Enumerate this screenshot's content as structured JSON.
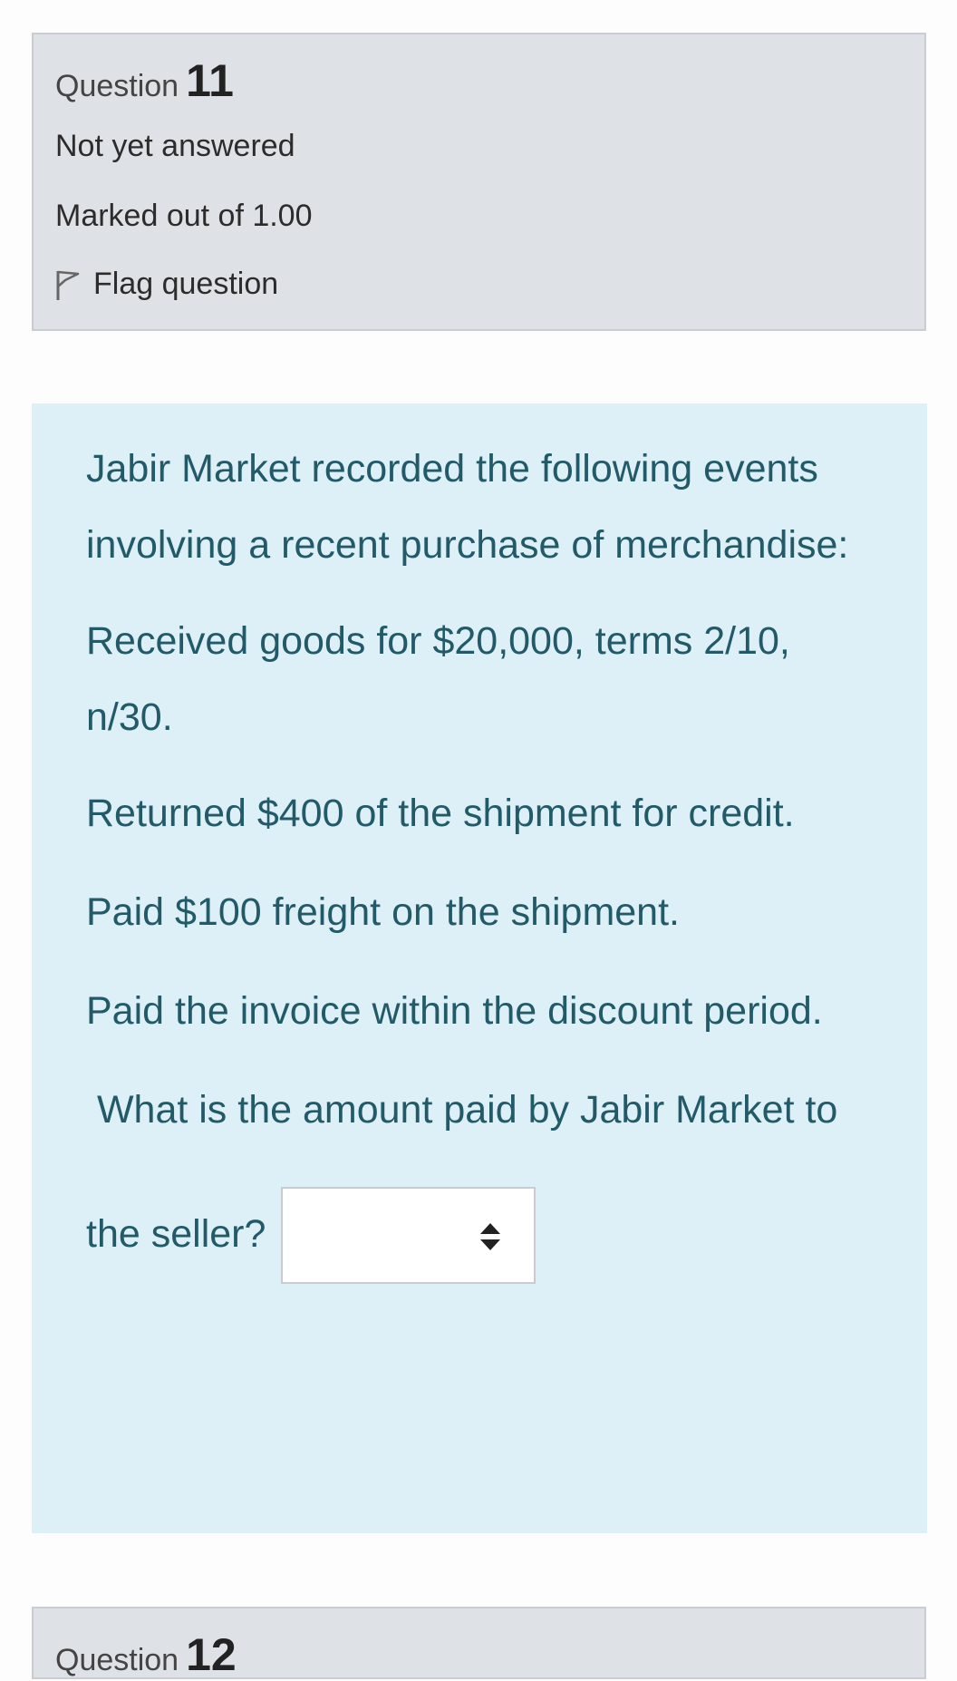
{
  "question": {
    "label": "Question",
    "number": "11",
    "state": "Not yet answered",
    "grade": "Marked out of 1.00",
    "flag_label": "Flag question"
  },
  "question_text": {
    "lines": [
      "Jabir Market recorded the following events",
      "involving a recent purchase of merchandise:",
      "Received goods for $20,000, terms 2/10,",
      "n/30.",
      "Returned $400 of the shipment for credit.",
      "Paid $100 freight on the shipment.",
      "Paid the invoice within the discount period.",
      " What is the amount paid by Jabir Market to",
      "the seller?"
    ]
  },
  "answer_select": {
    "selected": ""
  },
  "next_question": {
    "label": "Question",
    "number": "12"
  },
  "icons": {
    "flag": "flag-outline-icon",
    "select_arrows": "up-down-arrows-icon"
  },
  "colors": {
    "info_background": "#dee2e6",
    "content_background": "#def0f7",
    "question_text": "#235a68"
  }
}
